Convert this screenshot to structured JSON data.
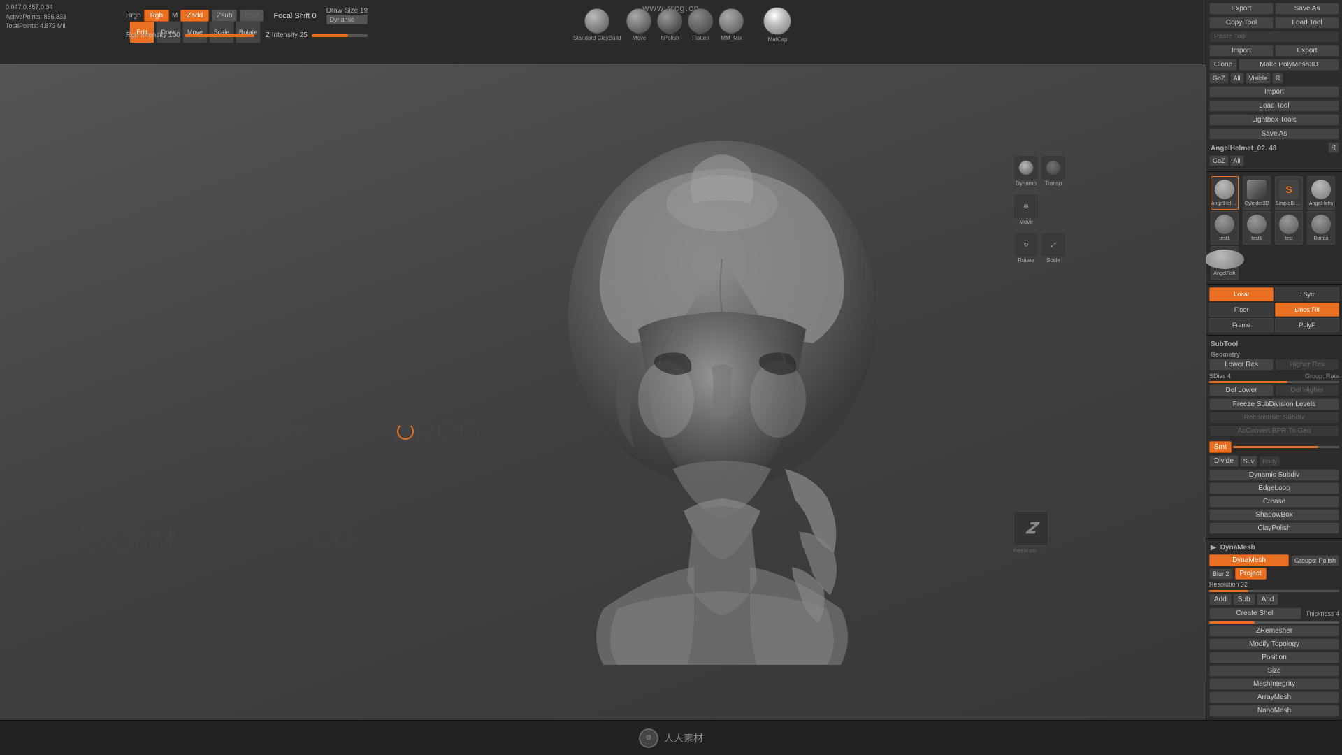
{
  "website": "www.rrcg.cn",
  "top_info": {
    "coords": "0.047,0.857,0.34",
    "active_points": "ActivePoints: 856,833",
    "total_points": "TotalPoints: 4.873 Mil"
  },
  "toolbar": {
    "edit": "Edit",
    "draw": "Draw",
    "move": "Move",
    "scale": "Scale",
    "rotate": "Rotate"
  },
  "brush_params": {
    "hrgb": "Hrgb",
    "rgb": "Rgb",
    "m_label": "M",
    "zadd": "Zadd",
    "zsub": "Zsub",
    "ecut": "Ecut",
    "focal_shift_label": "Focal Shift 0",
    "draw_size_label": "Draw Size 19",
    "dynamic_label": "Dynamic",
    "rgb_intensity_label": "Rgb Intensity 100",
    "z_intensity_label": "Z Intensity 25"
  },
  "brush_icons": [
    {
      "label": "Standard ClayBuild",
      "shape": "sphere"
    },
    {
      "label": "Move",
      "shape": "sphere"
    },
    {
      "label": "hPolish",
      "shape": "sphere"
    },
    {
      "label": "Flatten",
      "shape": "sphere"
    },
    {
      "label": "MM_Mix",
      "shape": "sphere"
    },
    {
      "label": "MatCap",
      "shape": "matcap"
    }
  ],
  "right_panel": {
    "export_section": {
      "export1": "Export",
      "save_as": "Save As",
      "copy_tool": "Copy Tool",
      "load_tool": "Load Tool",
      "paste_tool": "Paste Tool",
      "import": "Import",
      "export2": "Export",
      "clone": "Clone",
      "make_polymesh3d": "Make PolyMesh3D",
      "goz": "GoZ",
      "all": "All",
      "visible": "Visible",
      "r": "R",
      "import2": "Import",
      "load_tool2": "Load Tool",
      "lightbox_tools": "Lightbox Tools",
      "save_as2": "Save As",
      "angel_helmet": "AngelHelmet_02. 48",
      "goz2": "GoZ",
      "all2": "All",
      "r2": "R"
    },
    "tool_thumbs": [
      {
        "name": "AngelHelment_01",
        "shape": "angel"
      },
      {
        "name": "Cylinder3D PolyMesh3D",
        "shape": "cylinder"
      },
      {
        "name": "SimpleBrush AngelHelm",
        "shape": "S"
      },
      {
        "name": "test1",
        "shape": "test"
      },
      {
        "name": "test1",
        "shape": "test"
      },
      {
        "name": "test",
        "shape": "test"
      },
      {
        "name": "Danda",
        "shape": "test"
      },
      {
        "name": "AngelFish",
        "shape": "test"
      }
    ],
    "view_modes": {
      "local": "Local",
      "l_sym": "L Sym",
      "floor": "Floor",
      "lines_fill": "Lines Fill",
      "frame": "Frame",
      "poly_f": "PolyF"
    },
    "subtool": {
      "label": "SubTool",
      "geometry": "Geometry",
      "lower_res": "Lower Res",
      "higher_res": "Higher Res",
      "sdiv_label": "SDivs 4",
      "group_rate": "Group: Rate",
      "del_lower": "Del Lower",
      "del_higher": "Del Higher",
      "freeze_subdiv": "Freeze SubDivision Levels",
      "reconstruct_subdiv": "Reconstruct Subdiv",
      "convert_bpr_to_geo": "AcConvert BPR To Geo",
      "smt": "Smt",
      "divide": "Divide",
      "suv": "Suv",
      "rnity": "Rnity",
      "dynamic_subdiv": "Dynamic Subdiv",
      "edgeloop": "EdgeLoop",
      "crease": "Crease",
      "shadowbox": "ShadowBox",
      "claypolish": "ClayPolish"
    },
    "dynamesh": {
      "label": "DynaMesh",
      "dynamesh_btn": "DynaMesh",
      "groups_polish": "Groups: Polish",
      "blur": "Blur 2",
      "project": "Project",
      "resolution": "Resolution 32",
      "add": "Add",
      "sub": "Sub",
      "and": "And",
      "create_shell": "Create Shell",
      "thickness_label": "Thickness 4",
      "zremesher": "ZRemesher",
      "modify_topology": "Modify Topology",
      "position": "Position",
      "size": "Size",
      "mesh_integrity": "MeshIntegrity",
      "array_mesh": "ArrayMesh",
      "nano_mesh": "NanoMesh"
    }
  },
  "watermarks": [
    "RRCG",
    "人人素材"
  ],
  "bottom": {
    "logo_text": "人人素材"
  }
}
